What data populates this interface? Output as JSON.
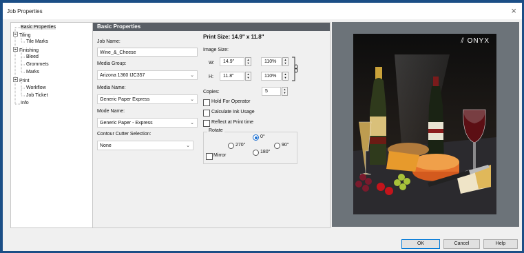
{
  "window": {
    "title": "Job Properties",
    "close": "×"
  },
  "tree": {
    "items": [
      {
        "label": "Basic Properties"
      },
      {
        "label": "Tiling"
      },
      {
        "label": "Tile Marks"
      },
      {
        "label": "Finishing"
      },
      {
        "label": "Bleed"
      },
      {
        "label": "Grommets"
      },
      {
        "label": "Marks"
      },
      {
        "label": "Print"
      },
      {
        "label": "Workflow"
      },
      {
        "label": "Job Ticket"
      },
      {
        "label": "Info"
      }
    ]
  },
  "panel": {
    "header": "Basic Properties",
    "job_name_label": "Job Name:",
    "job_name_value": "Wine_&_Cheese",
    "media_group_label": "Media Group:",
    "media_group_value": "Arizona 1360 IJC357",
    "media_name_label": "Media Name:",
    "media_name_value": "Generic Paper Express",
    "mode_name_label": "Mode Name:",
    "mode_name_value": "Generic Paper - Express",
    "contour_label": "Contour Cutter Selection:",
    "contour_value": "None"
  },
  "print": {
    "print_size": "Print Size: 14.9\" x 11.8\"",
    "image_size_label": "Image Size:",
    "w_label": "W:",
    "w_value": "14.9\"",
    "w_pct": "110%",
    "h_label": "H:",
    "h_value": "11.8\"",
    "h_pct": "110%",
    "copies_label": "Copies:",
    "copies_value": "5",
    "hold_label": "Hold For Operator",
    "ink_label": "Calculate Ink Usage",
    "reflect_label": "Reflect at Print time",
    "rotate_label": "Rotate",
    "r0": "0°",
    "r90": "90°",
    "r180": "180°",
    "r270": "270°",
    "mirror_label": "Mirror"
  },
  "preview": {
    "brand": "ONYX",
    "brand_mark": "⫽"
  },
  "buttons": {
    "ok": "OK",
    "cancel": "Cancel",
    "help": "Help"
  }
}
